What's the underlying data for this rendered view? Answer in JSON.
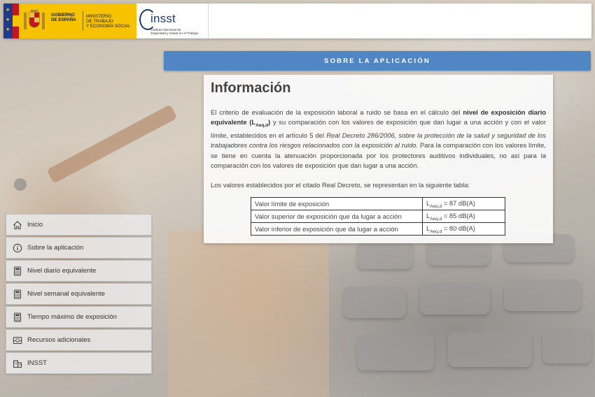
{
  "header": {
    "gov_name_lines": [
      "GOBIERNO",
      "DE ESPAÑA"
    ],
    "ministry_lines": [
      "MINISTERIO",
      "DE TRABAJO",
      "Y ECONOMÍA SOCIAL"
    ],
    "insst_name": "insst",
    "insst_sub_lines": [
      "Instituto Nacional de",
      "Seguridad y Salud en el Trabajo"
    ]
  },
  "title_bar": "SOBRE LA APLICACIÓN",
  "content": {
    "heading": "Información",
    "p1": {
      "t1": "El criterio de evaluación de la exposición laboral a ruido se basa en el cálculo del ",
      "b1": "nivel de exposición diario equivalente (L",
      "b1_sub": "Aeq,d",
      "b1_end": ")",
      "t2": " y su comparación con los valores de exposición que dan lugar a una acción y con el valor límite, establecidos en el artículo 5 del ",
      "i1": "Real Decreto 286/2006, sobre la protección de la salud y seguridad de los trabajadores contra los riesgos relacionados con la exposición al ruido.",
      "t3": " Para la comparación con los valores límite, se tiene en cuenta la atenuación proporcionada por los protectores auditivos individuales, no así para la comparación con los valores de exposición que dan lugar a una acción."
    },
    "p2": "Los valores establecidos por el citado Real Decreto, se representan en la siguiente tabla:",
    "table": [
      {
        "label": "Valor límite de exposición",
        "sym": "L",
        "sub": "Aeq,d",
        "value": " = 87 dB(A)"
      },
      {
        "label": "Valor superior de exposición que da lugar a acción",
        "sym": "L",
        "sub": "Aeq,d",
        "value": " = 85 dB(A)"
      },
      {
        "label": "Valor inferior de exposición que da lugar a acción",
        "sym": "L",
        "sub": "Aeq,d",
        "value": " = 80 dB(A)"
      }
    ]
  },
  "menu": [
    {
      "label": "Inicio",
      "icon": "home-icon"
    },
    {
      "label": "Sobre la aplicación",
      "icon": "info-icon"
    },
    {
      "label": "Nivel diario equivalente",
      "icon": "calculator-icon"
    },
    {
      "label": "Nivel semanal equivalente",
      "icon": "calculator-icon"
    },
    {
      "label": "Tiempo máximo de exposición",
      "icon": "calculator-icon"
    },
    {
      "label": "Recursos adicionales",
      "icon": "inbox-icon"
    },
    {
      "label": "INSST",
      "icon": "building-icon"
    }
  ],
  "colors": {
    "accent": "#4f86c3",
    "gov_yellow": "#f7c200",
    "gov_red": "#c4161c",
    "eu_blue": "#1d3a8f",
    "insst_blue": "#1f3a6e"
  }
}
